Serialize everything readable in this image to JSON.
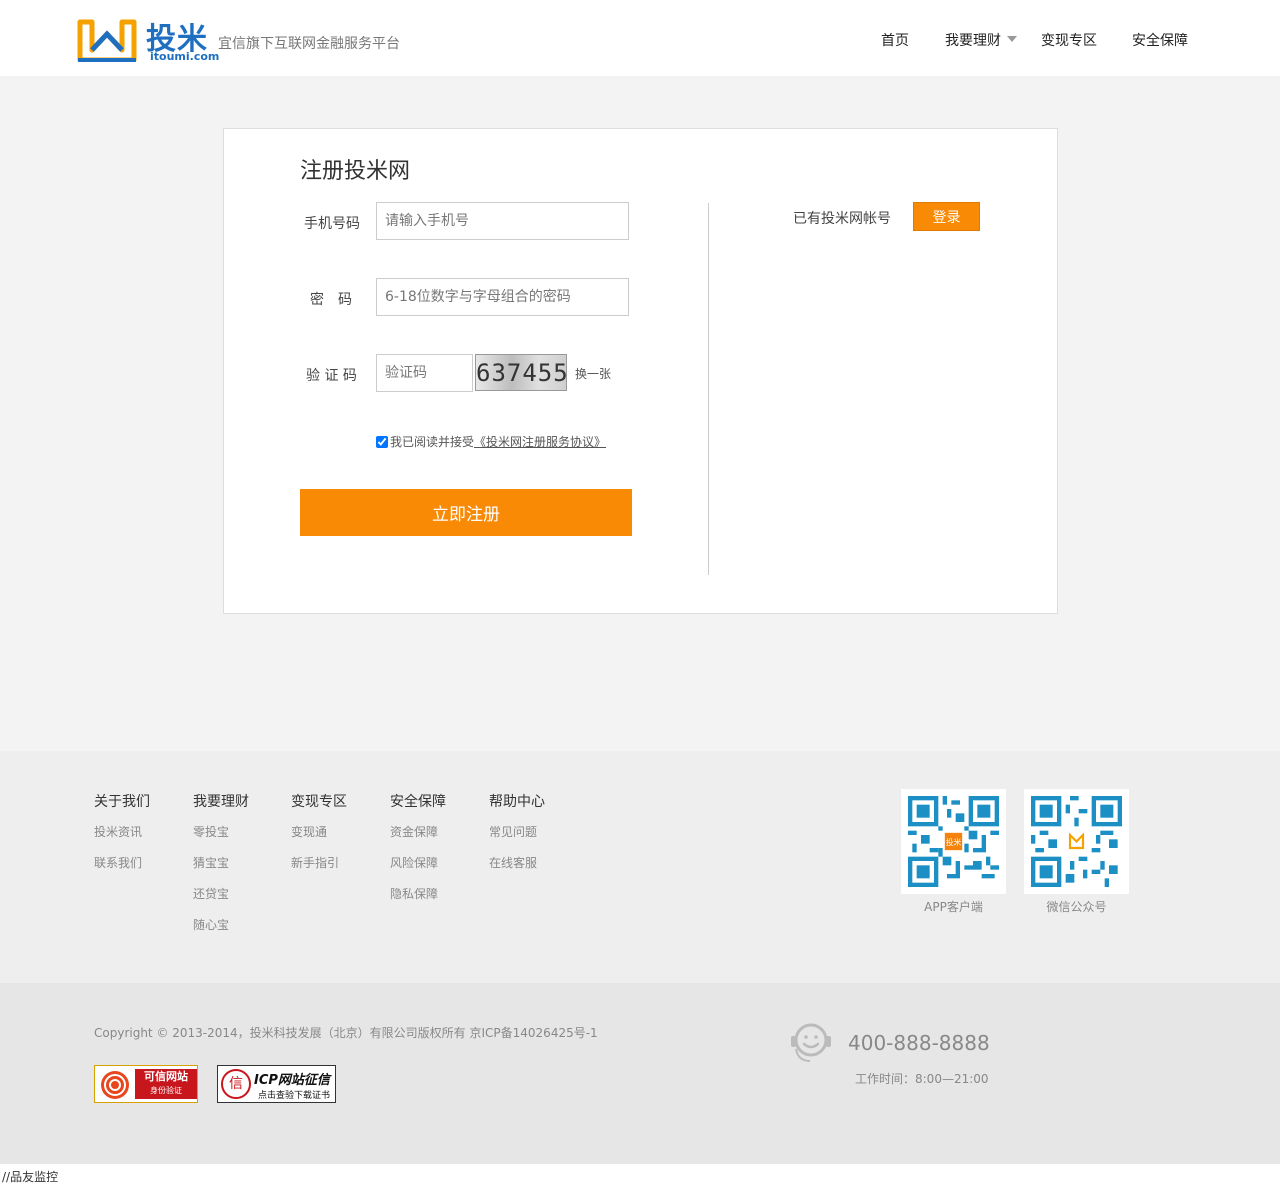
{
  "header": {
    "logo_text": "投米",
    "logo_domain": "itoumi.com",
    "slogan": "宜信旗下互联网金融服务平台",
    "nav": [
      {
        "label": "首页"
      },
      {
        "label": "我要理财"
      },
      {
        "label": "变现专区"
      },
      {
        "label": "安全保障"
      }
    ]
  },
  "register": {
    "title": "注册投米网",
    "phone_label": "手机号码",
    "phone_placeholder": "请输入手机号",
    "password_label": "密　码",
    "password_placeholder": "6-18位数字与字母组合的密码",
    "captcha_label": "验 证 码",
    "captcha_placeholder": "验证码",
    "captcha_image_text": "637455",
    "refresh_label": "换一张",
    "agree_text": "我已阅读并接受",
    "agreement_link": "《投米网注册服务协议》",
    "agree_checked": true,
    "submit_label": "立即注册",
    "have_account_text": "已有投米网帐号",
    "login_label": "登录"
  },
  "footer": {
    "columns": [
      {
        "title": "关于我们",
        "links": [
          "投米资讯",
          "联系我们"
        ]
      },
      {
        "title": "我要理财",
        "links": [
          "零投宝",
          "猜宝宝",
          "还贷宝",
          "随心宝"
        ]
      },
      {
        "title": "变现专区",
        "links": [
          "变现通",
          "新手指引"
        ]
      },
      {
        "title": "安全保障",
        "links": [
          "资金保障",
          "风险保障",
          "隐私保障"
        ]
      },
      {
        "title": "帮助中心",
        "links": [
          "常见问题",
          "在线客服"
        ]
      }
    ],
    "qr_app_label": "APP客户端",
    "qr_wechat_label": "微信公众号",
    "qr_app_center": "投米"
  },
  "bottom": {
    "copyright": "Copyright © 2013-2014，投米科技发展（北京）有限公司版权所有 京ICP备14026425号-1",
    "badge1_line1": "可信网站",
    "badge1_line2": "身份验证",
    "badge2_line1": "ICP网站征信",
    "badge2_line2": "点击查验下载证书",
    "badge2_seal": "信",
    "phone": "400-888-8888",
    "hours": "工作时间：8:00—21:00"
  },
  "statusbar": {
    "text": "//品友监控"
  },
  "colors": {
    "accent": "#f98a06",
    "brand_blue": "#1f6fc1"
  }
}
